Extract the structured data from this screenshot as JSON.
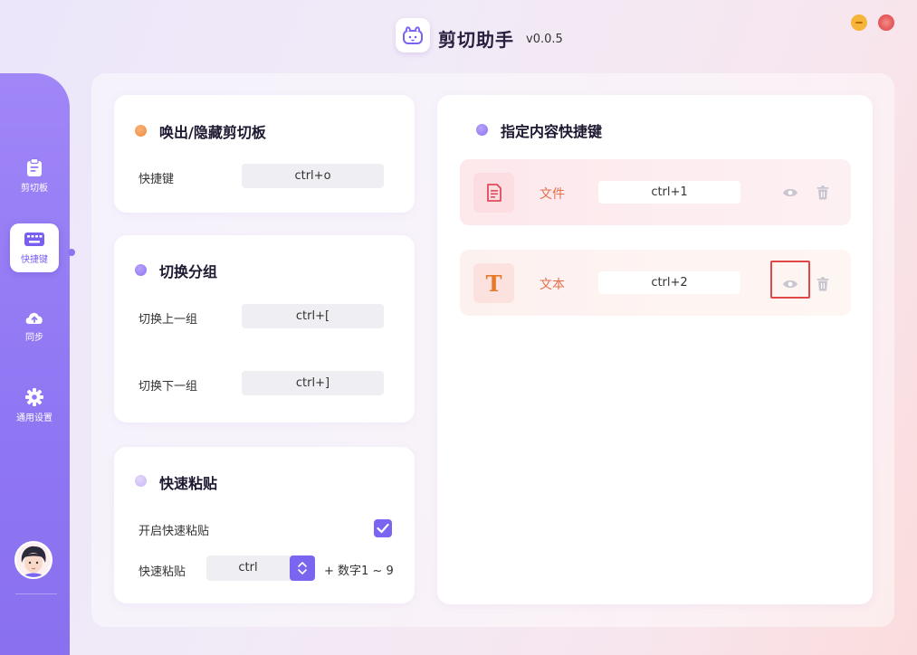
{
  "app": {
    "title": "剪切助手",
    "version": "v0.0.5"
  },
  "sidebar": {
    "items": [
      {
        "label": "剪切板",
        "icon": "clipboard-icon"
      },
      {
        "label": "快捷键",
        "icon": "keyboard-icon",
        "active": true
      },
      {
        "label": "同步",
        "icon": "cloud-upload-icon"
      },
      {
        "label": "通用设置",
        "icon": "gear-icon"
      }
    ]
  },
  "toggle_card": {
    "title": "唤出/隐藏剪切板",
    "label": "快捷键",
    "key": "ctrl+o"
  },
  "group_card": {
    "title": "切换分组",
    "prev_label": "切换上一组",
    "prev_key": "ctrl+[",
    "next_label": "切换下一组",
    "next_key": "ctrl+]"
  },
  "paste_card": {
    "title": "快速粘贴",
    "enable_label": "开启快速粘贴",
    "enabled": true,
    "modifier_label": "快速粘贴",
    "modifier_value": "ctrl",
    "suffix": "+ 数字1 ~ 9"
  },
  "content_card": {
    "title": "指定内容快捷键",
    "rows": [
      {
        "label": "文件",
        "key": "ctrl+1",
        "icon": "file-icon"
      },
      {
        "label": "文本",
        "key": "ctrl+2",
        "icon": "text-icon",
        "glyph": "T"
      }
    ]
  },
  "colors": {
    "accent": "#7a65f0",
    "sidebar": "#9078f4",
    "orange_dot": "#f08a3c",
    "purple_dot": "#9a80f5",
    "light_purple_dot": "#c9b6f5",
    "content_label": "#e0704d",
    "highlight": "#e04848"
  }
}
